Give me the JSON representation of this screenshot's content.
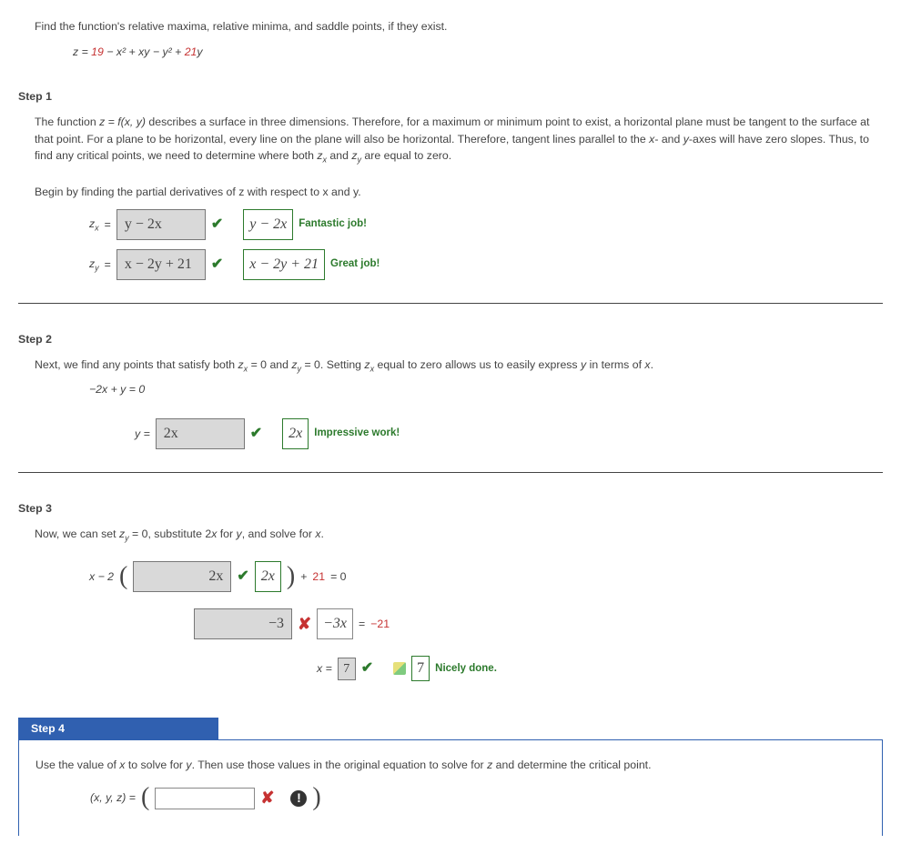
{
  "prompt": "Find the function's relative maxima, relative minima, and saddle points, if they exist.",
  "equation": {
    "prefix": "z = ",
    "c1": "19",
    "middle": " − x² + xy − y² + ",
    "c2": "21",
    "suffix": "y"
  },
  "step1": {
    "label": "Step 1",
    "text1a": "The function ",
    "text1b": " describes a surface in three dimensions. Therefore, for a maximum or minimum point to exist, a horizontal plane must be tangent to the surface at that point. For a plane to be horizontal, every line on the plane will also be horizontal. Therefore, tangent lines parallel to the ",
    "text1c": "- and ",
    "text1d": "-axes will have zero slopes. Thus, to find any critical points, we need to determine where both ",
    "text1e": " and ",
    "text1f": " are equal to zero.",
    "text2": "Begin by finding the partial derivatives of z with respect to x and y.",
    "zx_label": "z",
    "eq": " = ",
    "zx_answer": "y − 2x",
    "zx_correct": "y − 2x",
    "zx_feedback": "Fantastic job!",
    "zy_answer": "x − 2y + 21",
    "zy_correct": "x − 2y + 21",
    "zy_feedback": "Great job!"
  },
  "step2": {
    "label": "Step 2",
    "text1a": "Next, we find any points that satisfy both ",
    "text1b": " = 0  and ",
    "text1c": " = 0.  Setting ",
    "text1d": " equal to zero allows us to easily express ",
    "text1e": " in terms of ",
    "text1f": ".",
    "eq1": "−2x + y = 0",
    "ylabel": "y = ",
    "y_answer": "2x",
    "y_correct": "2x",
    "y_feedback": "Impressive work!"
  },
  "step3": {
    "label": "Step 3",
    "text1a": "Now, we can set ",
    "text1b": " = 0,  substitute 2",
    "text1c": " for ",
    "text1d": ", and solve for ",
    "text1e": ".",
    "l1_pre": "x − 2",
    "l1_ans": "2x",
    "l1_corr": "2x",
    "l1_post_a": " + ",
    "l1_post_b": "21",
    "l1_post_c": "  = 0",
    "l2_ans": "−3",
    "l2_corr": "−3x",
    "l2_rhs_eq": " = ",
    "l2_rhs": "−21",
    "l3_pre": "x = ",
    "l3_ans": "7",
    "l3_corr": "7",
    "l3_feedback": "Nicely done."
  },
  "step4": {
    "label": "Step 4",
    "text1a": "Use the value of ",
    "text1b": " to solve for ",
    "text1c": ". Then use those values in the original equation to solve for ",
    "text1d": " and determine the critical point.",
    "triplet": "(x, y, z) = "
  }
}
